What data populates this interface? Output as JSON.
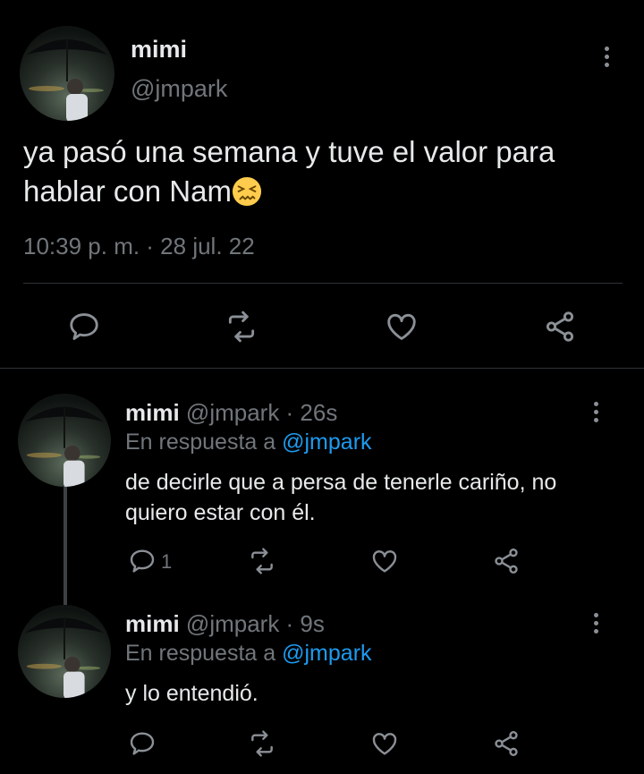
{
  "main_tweet": {
    "author_name": "mimi",
    "handle": "@jmpark",
    "text": "ya pasó una semana y tuve el valor para hablar con Nam",
    "emoji": "confounded-face",
    "timestamp": "10:39 p. m. · 28 jul. 22"
  },
  "replies": [
    {
      "author_name": "mimi",
      "meta": "@jmpark · 26s",
      "in_reply_prefix": "En respuesta a",
      "in_reply_handle": "@jmpark",
      "text": "de decirle que a persa de tenerle cariño, no quiero estar con él.",
      "reply_count": "1"
    },
    {
      "author_name": "mimi",
      "meta": "@jmpark · 9s",
      "in_reply_prefix": "En respuesta a",
      "in_reply_handle": "@jmpark",
      "text": "y lo entendió.",
      "reply_count": ""
    }
  ],
  "colors": {
    "background": "#000000",
    "text": "#e7e9ea",
    "muted": "#71767b",
    "link": "#1d9bf0",
    "divider": "#2f3336"
  }
}
